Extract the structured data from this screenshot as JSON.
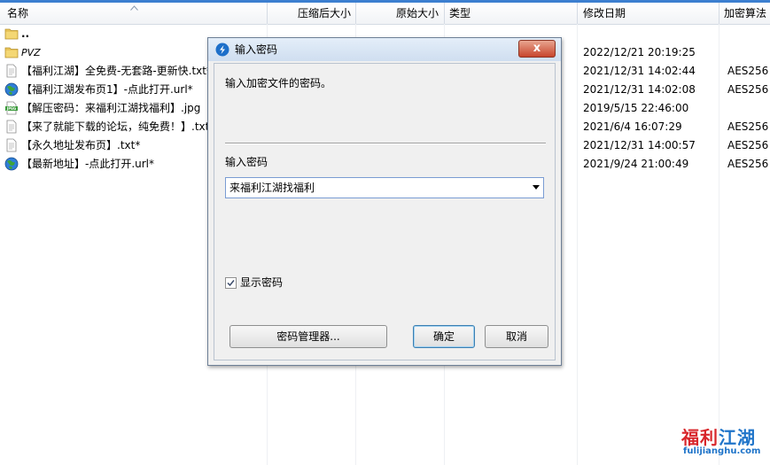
{
  "columns": {
    "name": "名称",
    "packed_size": "压缩后大小",
    "original_size": "原始大小",
    "type": "类型",
    "modified": "修改日期",
    "encryption": "加密算法"
  },
  "files": [
    {
      "name": "..",
      "icon": "folder-icon",
      "date": "",
      "enc": ""
    },
    {
      "name": "PVZ",
      "icon": "folder-icon",
      "date": "2022/12/21 20:19:25",
      "enc": ""
    },
    {
      "name": "【福利江湖】全免费-无套路-更新快.txt*",
      "icon": "text-file-icon",
      "date": "2021/12/31 14:02:44",
      "enc": "AES256"
    },
    {
      "name": "【福利江湖发布页1】-点此打开.url*",
      "icon": "globe-icon",
      "date": "2021/12/31 14:02:08",
      "enc": "AES256"
    },
    {
      "name": "【解压密码：来福利江湖找福利】.jpg",
      "icon": "jpeg-icon",
      "date": "2019/5/15 22:46:00",
      "enc": ""
    },
    {
      "name": "【来了就能下载的论坛，纯免费！】.txt",
      "icon": "text-file-icon",
      "date": "2021/6/4 16:07:29",
      "enc": "AES256"
    },
    {
      "name": "【永久地址发布页】.txt*",
      "icon": "text-file-icon",
      "date": "2021/12/31 14:00:57",
      "enc": "AES256"
    },
    {
      "name": "【最新地址】-点此打开.url*",
      "icon": "globe-icon",
      "date": "2021/9/24 21:00:49",
      "enc": "AES256"
    }
  ],
  "dialog": {
    "title": "输入密码",
    "close_label": "x",
    "description": "输入加密文件的密码。",
    "password_label": "输入密码",
    "password_value": "来福利江湖找福利",
    "show_password_label": "显示密码",
    "show_password_checked": true,
    "manager_button": "密码管理器...",
    "ok_button": "确定",
    "cancel_button": "取消"
  },
  "watermark": {
    "main_part1": "福利",
    "main_part2": "江湖",
    "sub": "fulijianghu.com"
  },
  "colors": {
    "accent": "#3c7fd0",
    "watermark_blue": "#1f74c9",
    "watermark_red": "#d8262b"
  }
}
